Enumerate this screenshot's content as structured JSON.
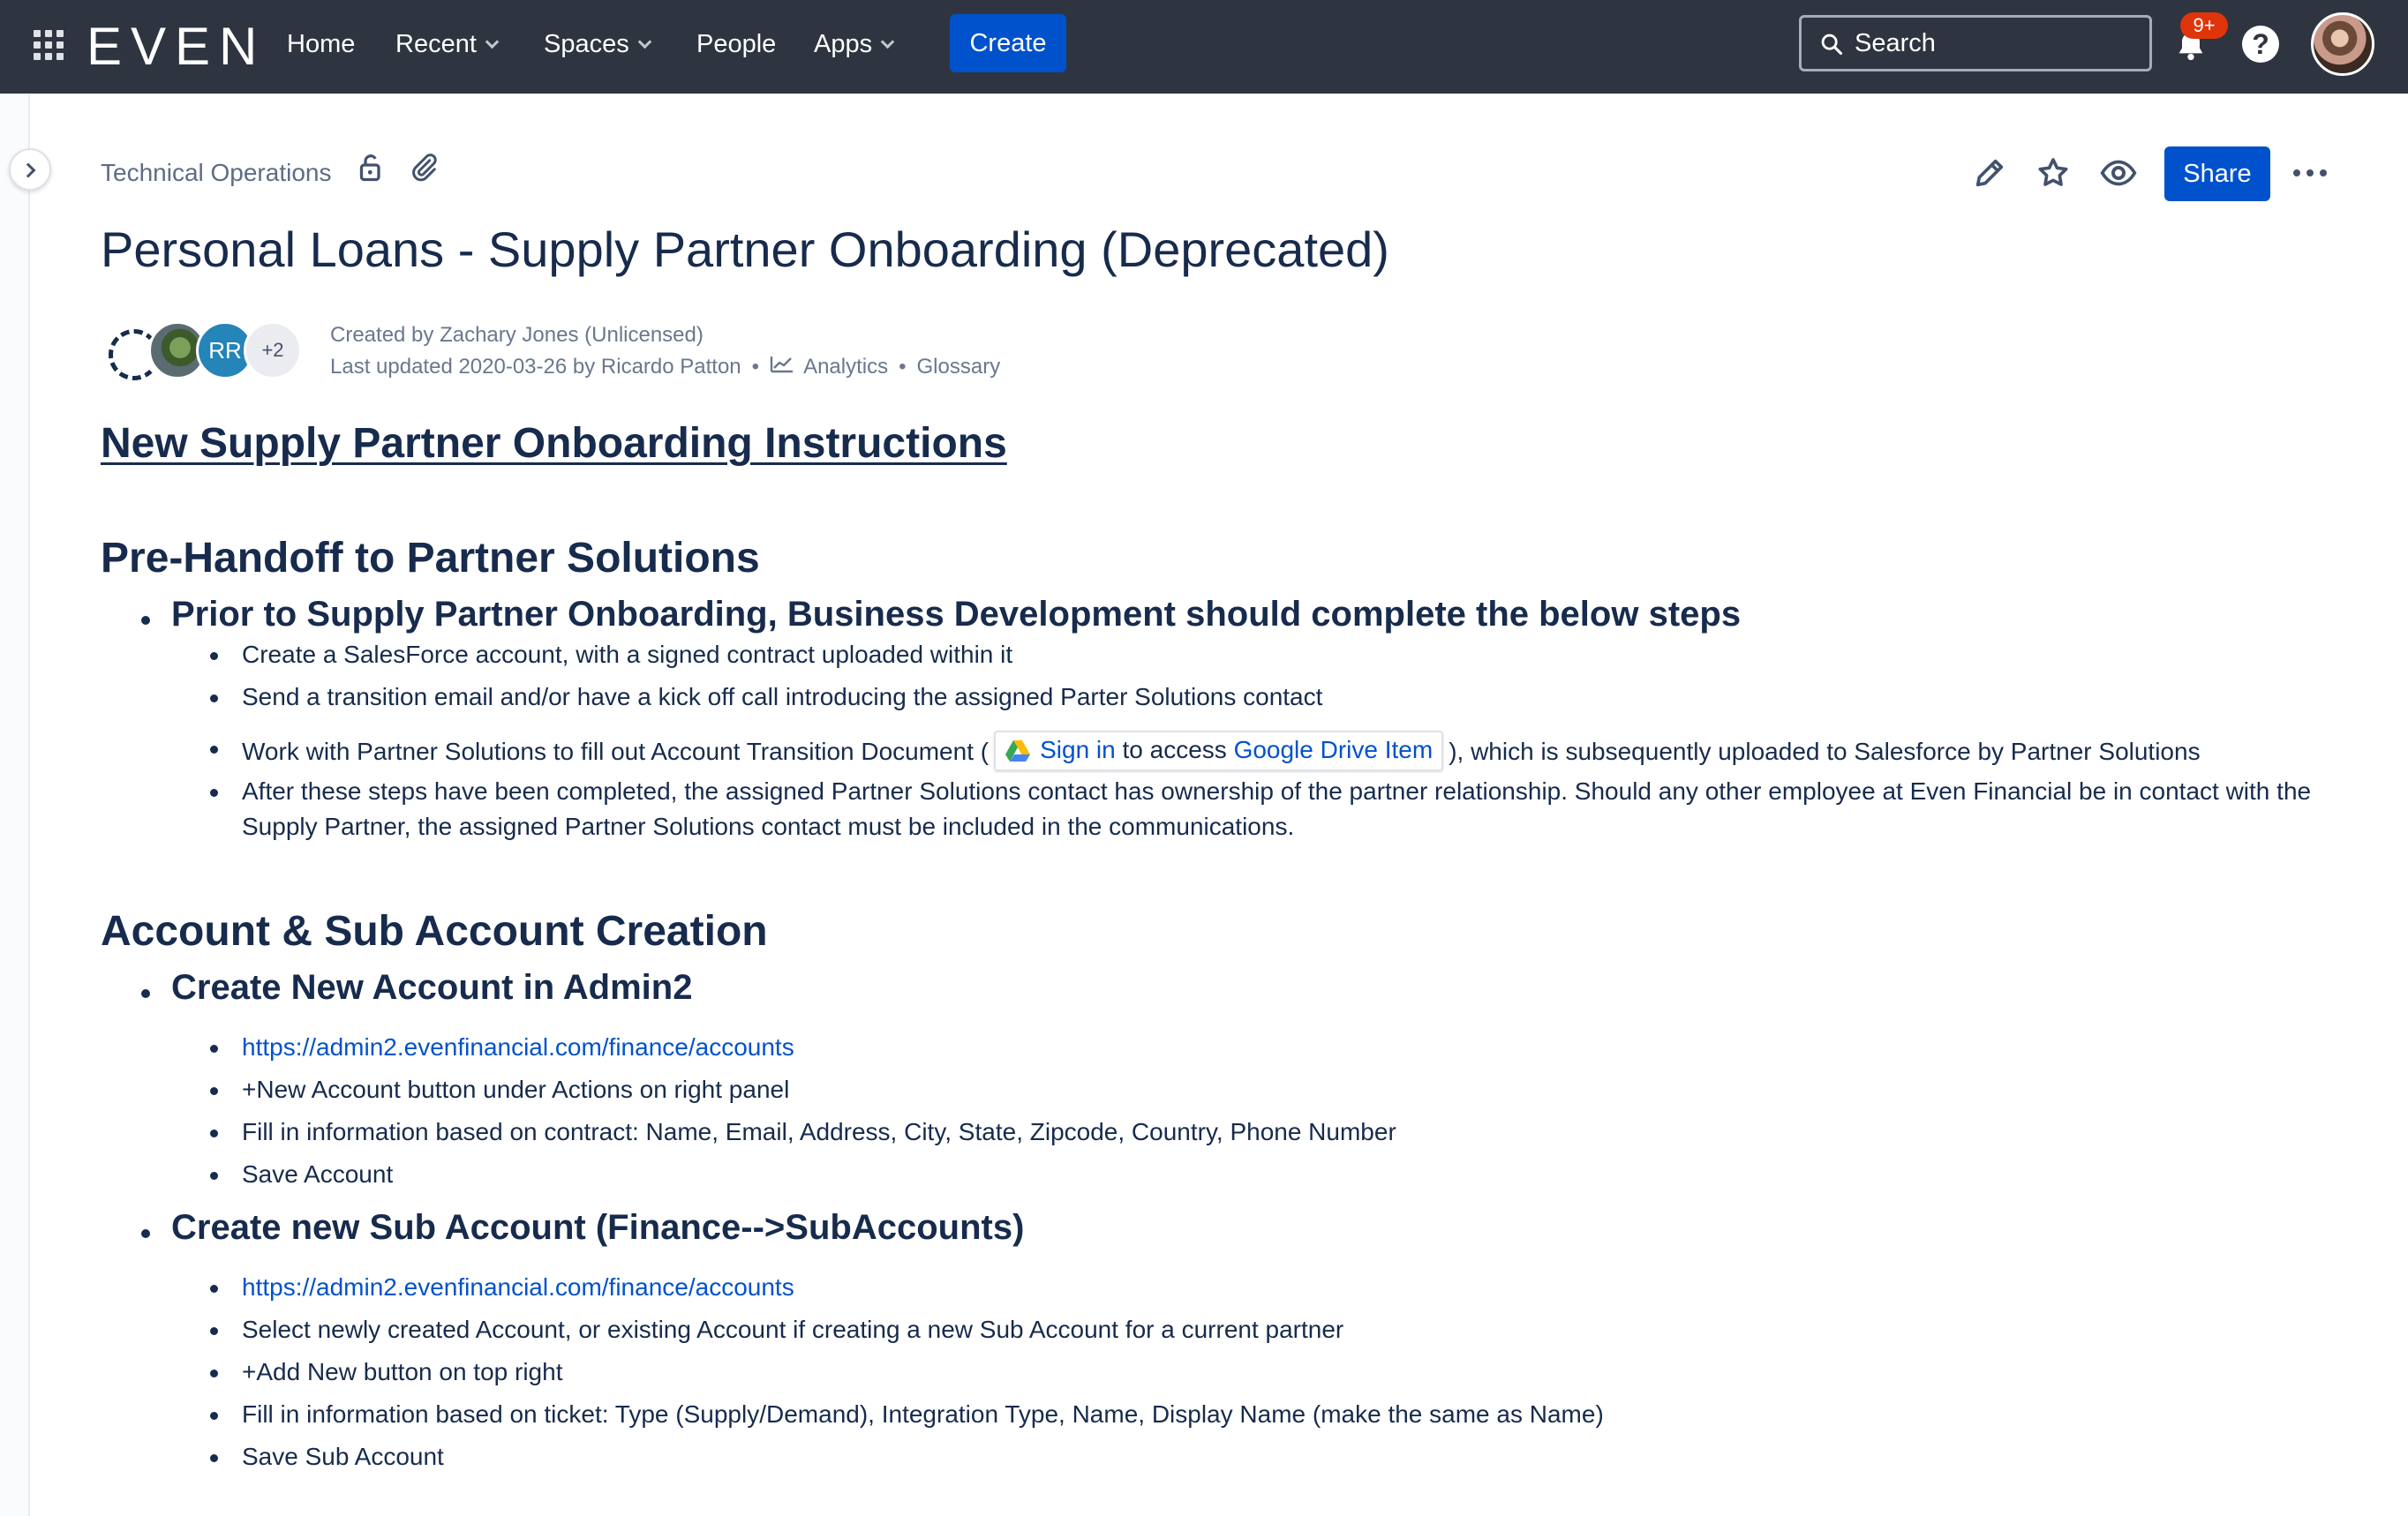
{
  "topnav": {
    "logo": "EVEN",
    "items": [
      {
        "label": "Home",
        "has_menu": false
      },
      {
        "label": "Recent",
        "has_menu": true
      },
      {
        "label": "Spaces",
        "has_menu": true
      },
      {
        "label": "People",
        "has_menu": false
      },
      {
        "label": "Apps",
        "has_menu": true
      }
    ],
    "create_label": "Create",
    "search_placeholder": "Search",
    "notifications_badge": "9+",
    "help_glyph": "?"
  },
  "breadcrumb": {
    "space": "Technical Operations"
  },
  "page_actions": {
    "share_label": "Share"
  },
  "page": {
    "title": "Personal Loans - Supply Partner Onboarding (Deprecated)",
    "contributors": {
      "initials": "RR",
      "more": "+2"
    },
    "created_by": "Created by Zachary Jones (Unlicensed)",
    "last_updated": "Last updated 2020-03-26 by Ricardo Patton",
    "analytics_label": "Analytics",
    "glossary_label": "Glossary"
  },
  "content": {
    "heading_link": "New Supply Partner Onboarding Instructions",
    "section1": {
      "title": "Pre-Handoff to Partner Solutions",
      "item_title": "Prior to Supply Partner Onboarding, Business Development should complete the below steps",
      "steps": {
        "s1": "Create a SalesForce account, with a signed contract uploaded within it",
        "s2": "Send a transition email and/or have a kick off call introducing the assigned Parter Solutions contact",
        "s3_before": "Work with Partner Solutions to fill out Account Transition Document (",
        "s3_chip_signin": "Sign in",
        "s3_chip_middle": " to access ",
        "s3_chip_item": "Google Drive Item",
        "s3_after": "), which is subsequently uploaded to Salesforce by Partner Solutions",
        "s4_line1": "After these steps have been completed, the assigned Partner Solutions contact has ownership of the partner relationship. Should any other employee at Even Financial be in contact with the",
        "s4_line2": "Supply Partner, the assigned Partner Solutions contact must be included in the communications."
      }
    },
    "section2": {
      "title": "Account & Sub Account Creation",
      "item1_title": "Create New Account in Admin2",
      "item1_steps": {
        "s1": "https://admin2.evenfinancial.com/finance/accounts",
        "s2": "+New Account button under Actions on right panel",
        "s3": "Fill in information based on contract: Name, Email, Address, City, State, Zipcode, Country, Phone Number",
        "s4": "Save Account"
      },
      "item2_title": "Create new Sub Account (Finance-->SubAccounts)",
      "item2_steps": {
        "s1": "https://admin2.evenfinancial.com/finance/accounts",
        "s2": "Select newly created Account, or existing Account if creating a new Sub Account for a current partner",
        "s3": "+Add New button on top right",
        "s4": "Fill in information based on ticket: Type (Supply/Demand), Integration Type, Name, Display Name (make the same as Name)",
        "s5": "Save Sub Account"
      }
    }
  },
  "colors": {
    "nav_bg": "#2e3540",
    "primary": "#0052cc",
    "text": "#172b4d",
    "muted": "#6b778c",
    "badge": "#de350b"
  }
}
